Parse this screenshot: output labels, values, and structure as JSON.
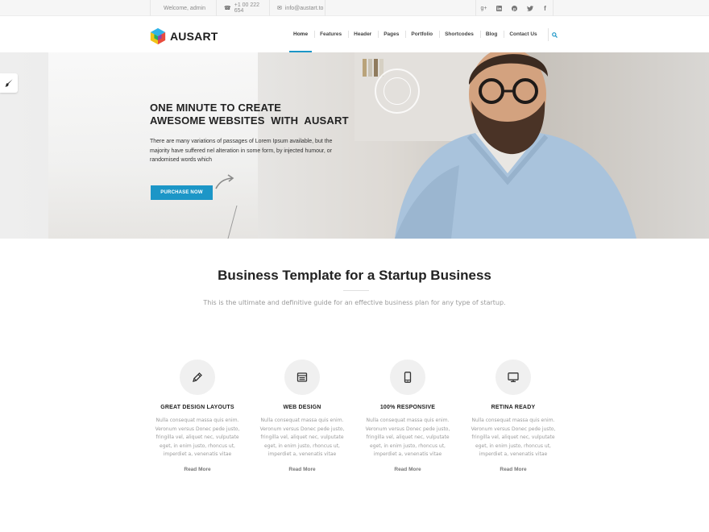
{
  "topbar": {
    "welcome": "Welcome, admin",
    "phone": "+1 00 222 654",
    "email": "info@austart.to",
    "phone_icon": "phone-icon",
    "mail_icon": "mail-icon",
    "socials": [
      {
        "name": "google-plus-icon",
        "glyph": "g+"
      },
      {
        "name": "linkedin-icon",
        "glyph": "in"
      },
      {
        "name": "pinterest-icon",
        "glyph": "P"
      },
      {
        "name": "twitter-icon",
        "glyph": "t"
      },
      {
        "name": "facebook-icon",
        "glyph": "f"
      }
    ]
  },
  "header": {
    "brand": "AUSART",
    "nav": [
      "Home",
      "Features",
      "Header",
      "Pages",
      "Portfolio",
      "Shortcodes",
      "Blog",
      "Contact Us"
    ],
    "active_nav": "Home",
    "accent_color": "#1c96c7"
  },
  "hero": {
    "title_line1": "ONE MINUTE TO CREATE",
    "title_line2": "AWESOME WEBSITES  WITH  AUSART",
    "text": "There are many variations of passages of Lorem Ipsum available, but the majority have suffered nel alteration in some form, by injected humour, or randomised words which",
    "button": "PURCHASE NOW"
  },
  "section": {
    "title": "Business Template for a Startup Business",
    "subtitle": "This is the ultimate and definitive guide for an effective business plan for any type of startup."
  },
  "features": [
    {
      "icon": "pencil-icon",
      "title": "GREAT DESIGN LAYOUTS",
      "text": "Nulla consequat massa quis enim. Veronum versus Donec pede justo, fringilla vel, aliquet nec, vulputate eget, in enim justo, rhoncus ut, imperdiet a, venenatis vitae",
      "more": "Read More"
    },
    {
      "icon": "browser-icon",
      "title": "WEB DESIGN",
      "text": "Nulla consequat massa quis enim. Veronum versus Donec pede justo, fringilla vel, aliquet nec, vulputate eget, in enim justo, rhoncus ut, imperdiet a, venenatis vitae",
      "more": "Read More"
    },
    {
      "icon": "mobile-icon",
      "title": "100% RESPONSIVE",
      "text": "Nulla consequat massa quis enim. Veronum versus Donec pede justo, fringilla vel, aliquet nec, vulputate eget, in enim justo, rhoncus ut, imperdiet a, venenatis vitae",
      "more": "Read More"
    },
    {
      "icon": "monitor-icon",
      "title": "RETINA READY",
      "text": "Nulla consequat massa quis enim. Veronum versus Donec pede justo, fringilla vel, aliquet nec, vulputate eget, in enim justo, rhoncus ut, imperdiet a, venenatis vitae",
      "more": "Read More"
    }
  ]
}
